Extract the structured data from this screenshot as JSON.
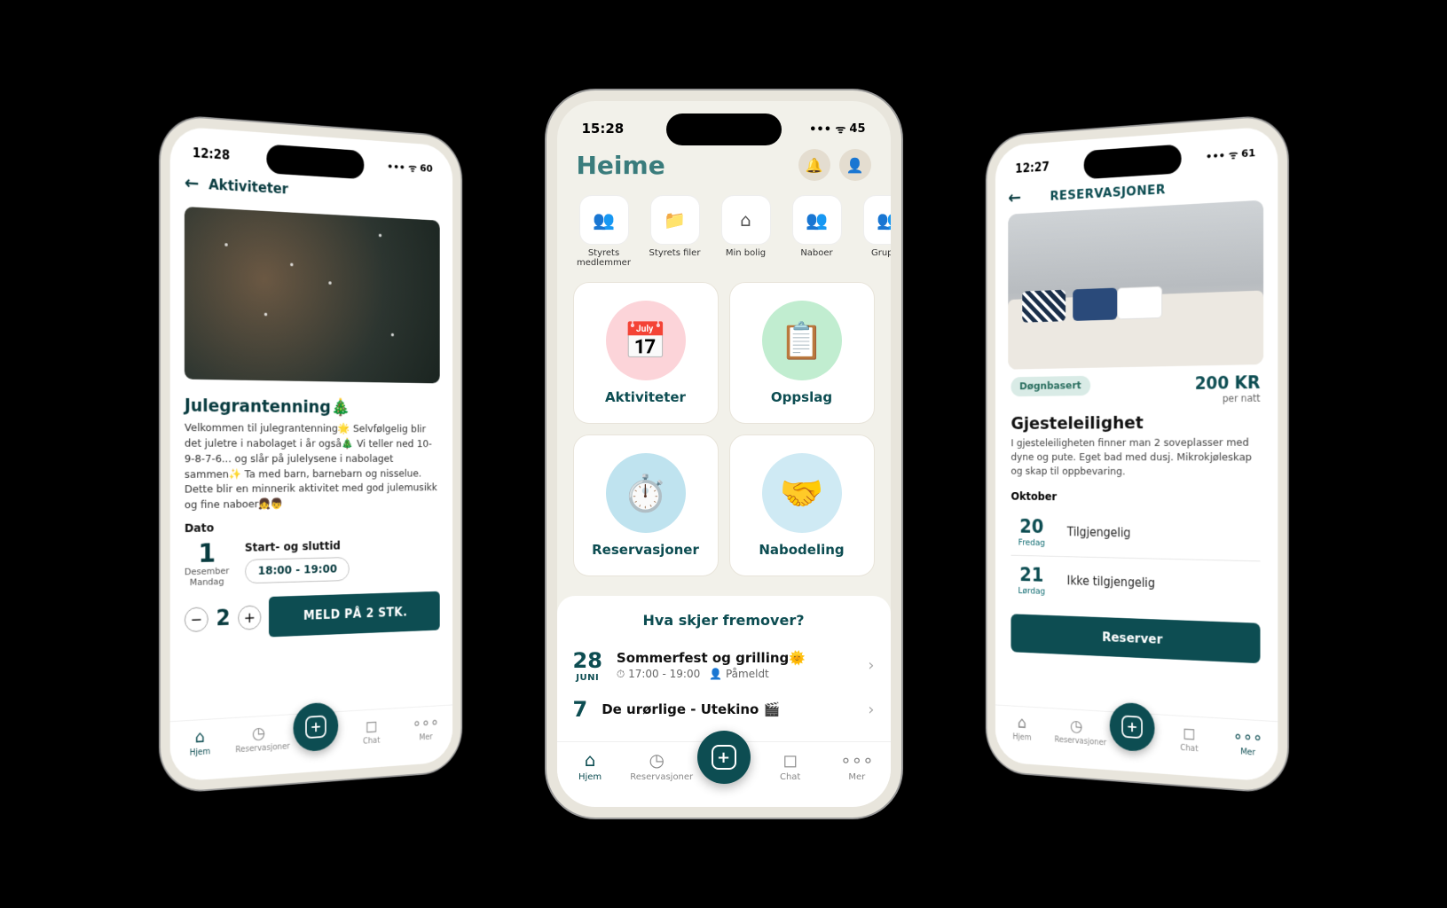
{
  "phone1": {
    "status_time": "12:28",
    "status_batt": "60",
    "header": "Aktiviteter",
    "event_title": "Julegrantenning🎄",
    "event_desc": "Velkommen til julegrantenning🌟 Selvfølgelig blir det juletre i nabolaget i år også🎄 Vi teller ned 10-9-8-7-6... og slår på julelysene i nabolaget sammen✨ Ta med barn, barnebarn og nisselue. Dette blir en minnerik aktivitet med god julemusikk og fine naboer👧👦",
    "date_label": "Dato",
    "day_num": "1",
    "day_month": "Desember",
    "day_name": "Mandag",
    "time_label": "Start- og sluttid",
    "time_range": "18:00 - 19:00",
    "qty": "2",
    "signup": "MELD PÅ 2 STK."
  },
  "phone2": {
    "status_time": "15:28",
    "status_batt": "45",
    "logo": "Heime",
    "quick": [
      {
        "label": "Styrets medlemmer"
      },
      {
        "label": "Styrets filer"
      },
      {
        "label": "Min bolig"
      },
      {
        "label": "Naboer"
      },
      {
        "label": "Gruppe"
      }
    ],
    "cards": {
      "aktiviteter": "Aktiviteter",
      "oppslag": "Oppslag",
      "reservasjoner": "Reservasjoner",
      "nabodeling": "Nabodeling"
    },
    "upcoming_title": "Hva skjer fremover?",
    "events": [
      {
        "daynum": "28",
        "month": "JUNI",
        "title": "Sommerfest og grilling🌞",
        "time": "17:00 - 19:00",
        "status": "Påmeldt"
      },
      {
        "daynum": "7",
        "month": "",
        "title": "De urørlige - Utekino 🎬",
        "time": "",
        "status": ""
      }
    ]
  },
  "phone3": {
    "status_time": "12:27",
    "status_batt": "61",
    "header": "RESERVASJONER",
    "tag": "Døgnbasert",
    "price": "200 KR",
    "price_sub": "per natt",
    "name": "Gjesteleilighet",
    "desc": "I gjesteleiligheten finner man 2 soveplasser med dyne og pute. Eget bad med dusj. Mikrokjøleskap og skap til oppbevaring.",
    "month": "Oktober",
    "avail": [
      {
        "num": "20",
        "day": "Fredag",
        "status": "Tilgjengelig"
      },
      {
        "num": "21",
        "day": "Lørdag",
        "status": "Ikke tilgjengelig"
      }
    ],
    "reserve": "Reserver"
  },
  "nav": {
    "hjem": "Hjem",
    "reservasjoner": "Reservasjoner",
    "chat": "Chat",
    "mer": "Mer"
  }
}
